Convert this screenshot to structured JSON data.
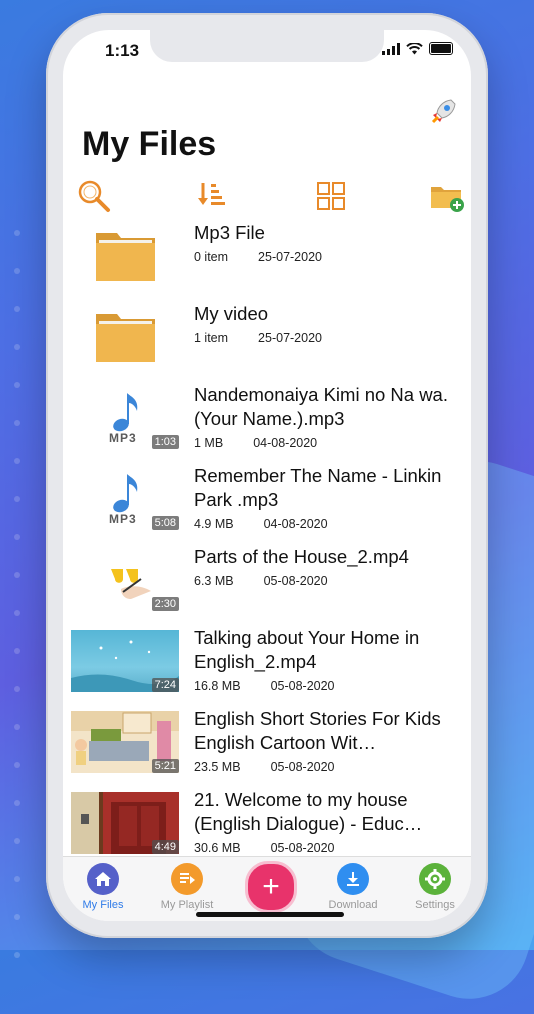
{
  "status": {
    "time": "1:13"
  },
  "header": {
    "title": "My Files"
  },
  "files": [
    {
      "name": "Mp3 File",
      "info": "0 item",
      "date": "25-07-2020",
      "kind": "folder"
    },
    {
      "name": "My video",
      "info": "1 item",
      "date": "25-07-2020",
      "kind": "folder"
    },
    {
      "name": "Nandemonaiya Kimi no Na wa. (Your Name.).mp3",
      "info": "1 MB",
      "date": "04-08-2020",
      "kind": "audio",
      "duration": "1:03",
      "badge": "MP3"
    },
    {
      "name": "Remember The Name - Linkin Park .mp3",
      "info": "4.9 MB",
      "date": "04-08-2020",
      "kind": "audio",
      "duration": "5:08",
      "badge": "MP3"
    },
    {
      "name": "Parts of the House_2.mp4",
      "info": "6.3 MB",
      "date": "05-08-2020",
      "kind": "video",
      "duration": "2:30"
    },
    {
      "name": "Talking about Your Home in English_2.mp4",
      "info": "16.8 MB",
      "date": "05-08-2020",
      "kind": "video",
      "duration": "7:24"
    },
    {
      "name": "English Short Stories For Kids  English Cartoon Wit…",
      "info": "23.5 MB",
      "date": "05-08-2020",
      "kind": "video",
      "duration": "5:21"
    },
    {
      "name": "21. Welcome to my house (English Dialogue) - Educ…",
      "info": "30.6 MB",
      "date": "05-08-2020",
      "kind": "video",
      "duration": "4:49"
    }
  ],
  "tabbar": {
    "my_files": "My Files",
    "my_playlist": "My Playlist",
    "download": "Download",
    "settings": "Settings"
  },
  "colors": {
    "accent": "#2f7be8",
    "icon_orange": "#e88a2a",
    "fab": "#e8336b"
  }
}
